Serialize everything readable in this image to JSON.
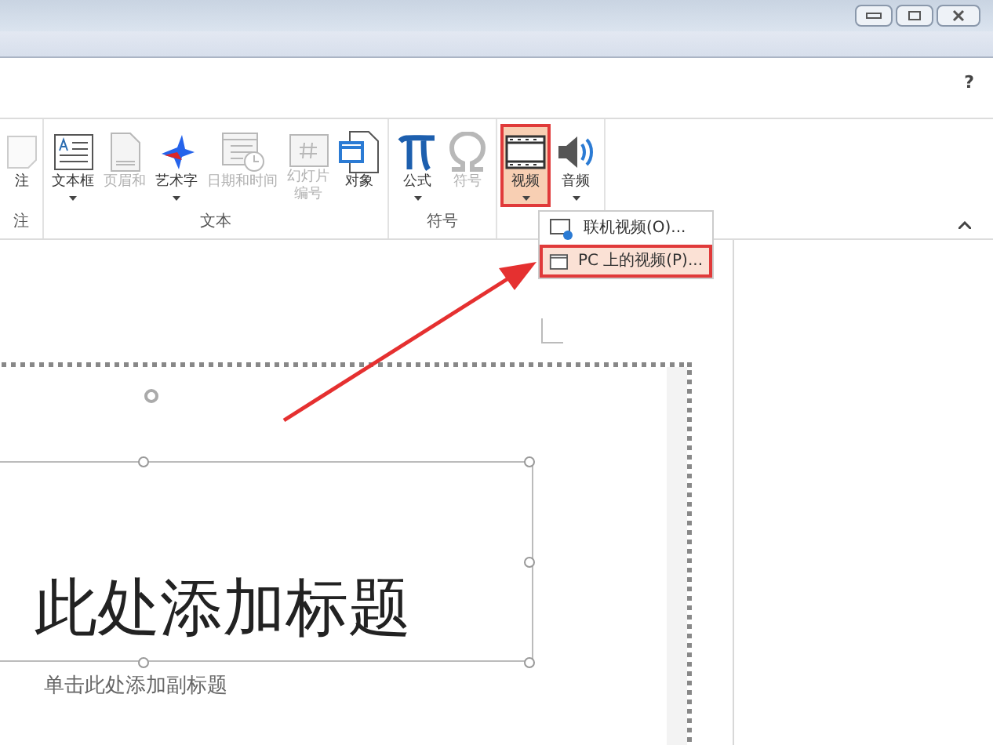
{
  "help": "?",
  "ribbon_groups": [
    {
      "label": "注",
      "buttons": [
        {
          "label": [
            "注"
          ],
          "kind": "note",
          "disabled": false,
          "dropdown": false,
          "selected": false
        }
      ]
    },
    {
      "label": "文本",
      "buttons": [
        {
          "label": [
            "文本框"
          ],
          "kind": "textbox",
          "disabled": false,
          "dropdown": true,
          "selected": false
        },
        {
          "label": [
            "页眉和"
          ],
          "kind": "page",
          "disabled": true,
          "dropdown": false,
          "selected": false
        },
        {
          "label": [
            "艺术字"
          ],
          "kind": "wordart",
          "disabled": false,
          "dropdown": true,
          "selected": false
        },
        {
          "label": [
            "日期和时间"
          ],
          "kind": "calendar",
          "disabled": true,
          "dropdown": false,
          "selected": false
        },
        {
          "label": [
            "幻灯片",
            "编号"
          ],
          "kind": "number",
          "disabled": true,
          "dropdown": false,
          "selected": false
        },
        {
          "label": [
            "对象"
          ],
          "kind": "object",
          "disabled": false,
          "dropdown": false,
          "selected": false
        }
      ]
    },
    {
      "label": "符号",
      "buttons": [
        {
          "label": [
            "公式"
          ],
          "kind": "pi",
          "disabled": false,
          "dropdown": true,
          "selected": false
        },
        {
          "label": [
            "符号"
          ],
          "kind": "omega",
          "disabled": true,
          "dropdown": false,
          "selected": false
        }
      ]
    },
    {
      "buttons": [
        {
          "label": [
            "视频"
          ],
          "kind": "film",
          "disabled": false,
          "dropdown": true,
          "selected": true
        },
        {
          "label": [
            "音频"
          ],
          "kind": "speaker",
          "disabled": false,
          "dropdown": true,
          "selected": false
        }
      ]
    }
  ],
  "video_menu": [
    {
      "label": "联机视频(O)...",
      "kind": "online",
      "selected": false
    },
    {
      "label": "PC 上的视频(P)...",
      "kind": "pc",
      "selected": true
    }
  ],
  "slide": {
    "title": "此处添加标题",
    "subtitle": "单击此处添加副标题"
  }
}
